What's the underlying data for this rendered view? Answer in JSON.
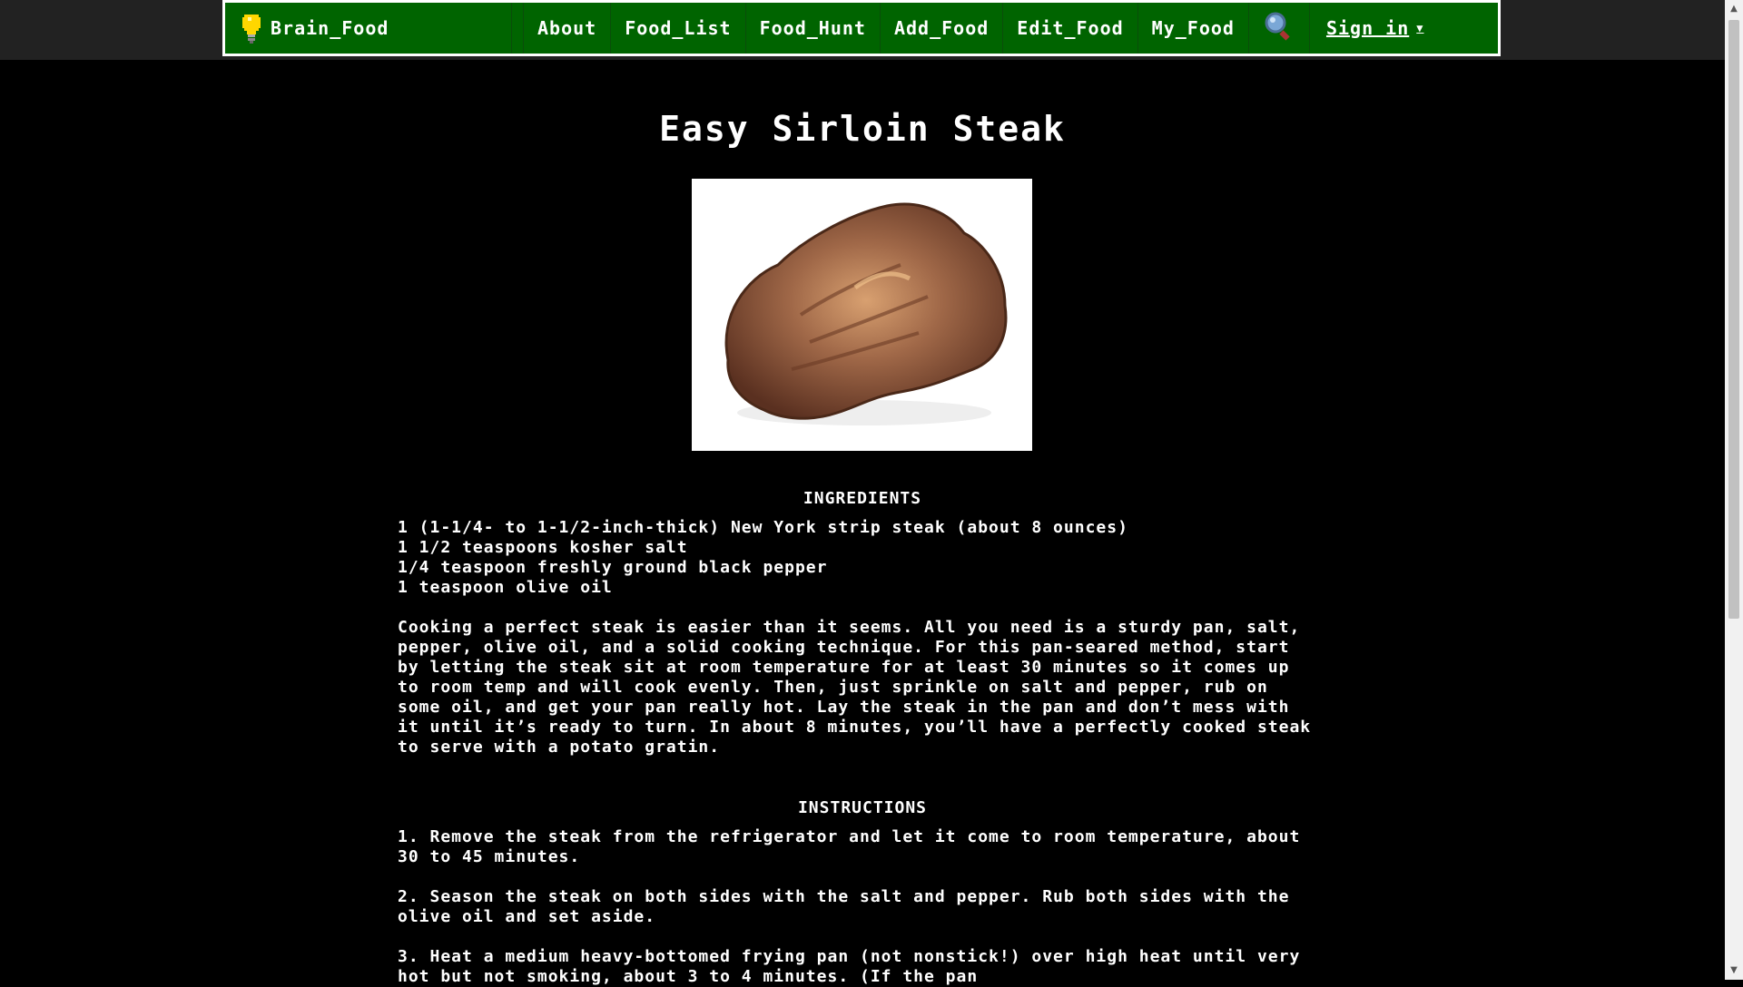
{
  "navbar": {
    "brand": "Brain_Food",
    "items": [
      "About",
      "Food_List",
      "Food_Hunt",
      "Add_Food",
      "Edit_Food",
      "My_Food"
    ],
    "signin": "Sign in"
  },
  "recipe": {
    "title": "Easy Sirloin Steak",
    "ingredients_heading": "INGREDIENTS",
    "ingredients": [
      "1 (1-1/4- to 1-1/2-inch-thick) New York strip steak (about 8 ounces)",
      "1 1/2 teaspoons kosher salt",
      "1/4 teaspoon freshly ground black pepper",
      "1 teaspoon olive oil"
    ],
    "description": "Cooking a perfect steak is easier than it seems. All you need is a sturdy pan, salt, pepper, olive oil, and a solid cooking technique. For this pan-seared method, start by letting the steak sit at room temperature for at least 30 minutes so it comes up to room temp and will cook evenly. Then, just sprinkle on salt and pepper, rub on some oil, and get your pan really hot. Lay the steak in the pan and don’t mess with it until it’s ready to turn. In about 8 minutes, you’ll have a perfectly cooked steak to serve with a potato gratin.",
    "instructions_heading": "INSTRUCTIONS",
    "instructions": [
      "1. Remove the steak from the refrigerator and let it come to room temperature, about 30 to 45 minutes.",
      "2. Season the steak on both sides with the salt and pepper. Rub both sides with the olive oil and set aside.",
      "3. Heat a medium heavy-bottomed frying pan (not nonstick!) over high heat until very hot but not smoking, about 3 to 4 minutes. (If the pan"
    ]
  }
}
